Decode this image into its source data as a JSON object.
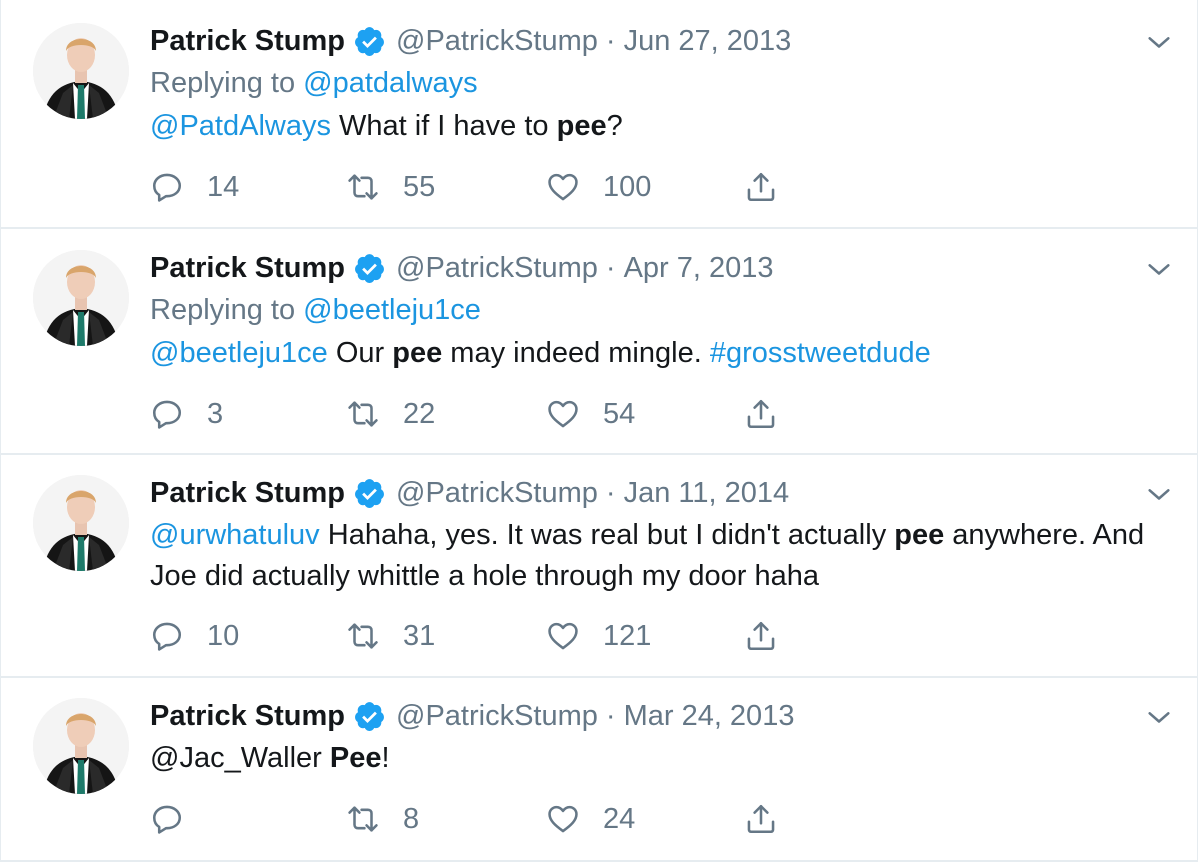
{
  "tweets": [
    {
      "author": {
        "name": "Patrick Stump",
        "handle": "@PatrickStump"
      },
      "date": "Jun 27, 2013",
      "reply_prefix": "Replying to",
      "reply_to": "@patdalways",
      "text_parts": [
        {
          "text": "@PatdAlways",
          "style": "link"
        },
        {
          "text": " What if I have to ",
          "style": "plain"
        },
        {
          "text": "pee",
          "style": "bold"
        },
        {
          "text": "?",
          "style": "plain"
        }
      ],
      "stats": {
        "replies": "14",
        "retweets": "55",
        "likes": "100"
      }
    },
    {
      "author": {
        "name": "Patrick Stump",
        "handle": "@PatrickStump"
      },
      "date": "Apr 7, 2013",
      "reply_prefix": "Replying to",
      "reply_to": "@beetleju1ce",
      "text_parts": [
        {
          "text": "@beetleju1ce",
          "style": "link"
        },
        {
          "text": " Our ",
          "style": "plain"
        },
        {
          "text": "pee",
          "style": "bold"
        },
        {
          "text": " may indeed mingle. ",
          "style": "plain"
        },
        {
          "text": "#grosstweetdude",
          "style": "link"
        }
      ],
      "stats": {
        "replies": "3",
        "retweets": "22",
        "likes": "54"
      }
    },
    {
      "author": {
        "name": "Patrick Stump",
        "handle": "@PatrickStump"
      },
      "date": "Jan 11, 2014",
      "text_parts": [
        {
          "text": "@urwhatuluv",
          "style": "link"
        },
        {
          "text": " Hahaha, yes. It was real but I didn't actually ",
          "style": "plain"
        },
        {
          "text": "pee",
          "style": "bold"
        },
        {
          "text": " anywhere. And Joe did actually whittle a hole through my door haha",
          "style": "plain"
        }
      ],
      "stats": {
        "replies": "10",
        "retweets": "31",
        "likes": "121"
      }
    },
    {
      "author": {
        "name": "Patrick Stump",
        "handle": "@PatrickStump"
      },
      "date": "Mar 24, 2013",
      "text_parts": [
        {
          "text": "@Jac_Waller ",
          "style": "plain"
        },
        {
          "text": "Pee",
          "style": "bold"
        },
        {
          "text": "!",
          "style": "plain"
        }
      ],
      "stats": {
        "replies": "",
        "retweets": "8",
        "likes": "24"
      }
    }
  ],
  "separator": "·",
  "icons": {
    "verified": "verified-badge-icon",
    "menu": "chevron-down-icon",
    "reply": "reply-icon",
    "retweet": "retweet-icon",
    "like": "heart-icon",
    "share": "share-icon"
  },
  "colors": {
    "link": "#1b95e0",
    "muted": "#657786",
    "text": "#14171a",
    "verified": "#1da1f2",
    "divider": "#e6ecf0"
  }
}
